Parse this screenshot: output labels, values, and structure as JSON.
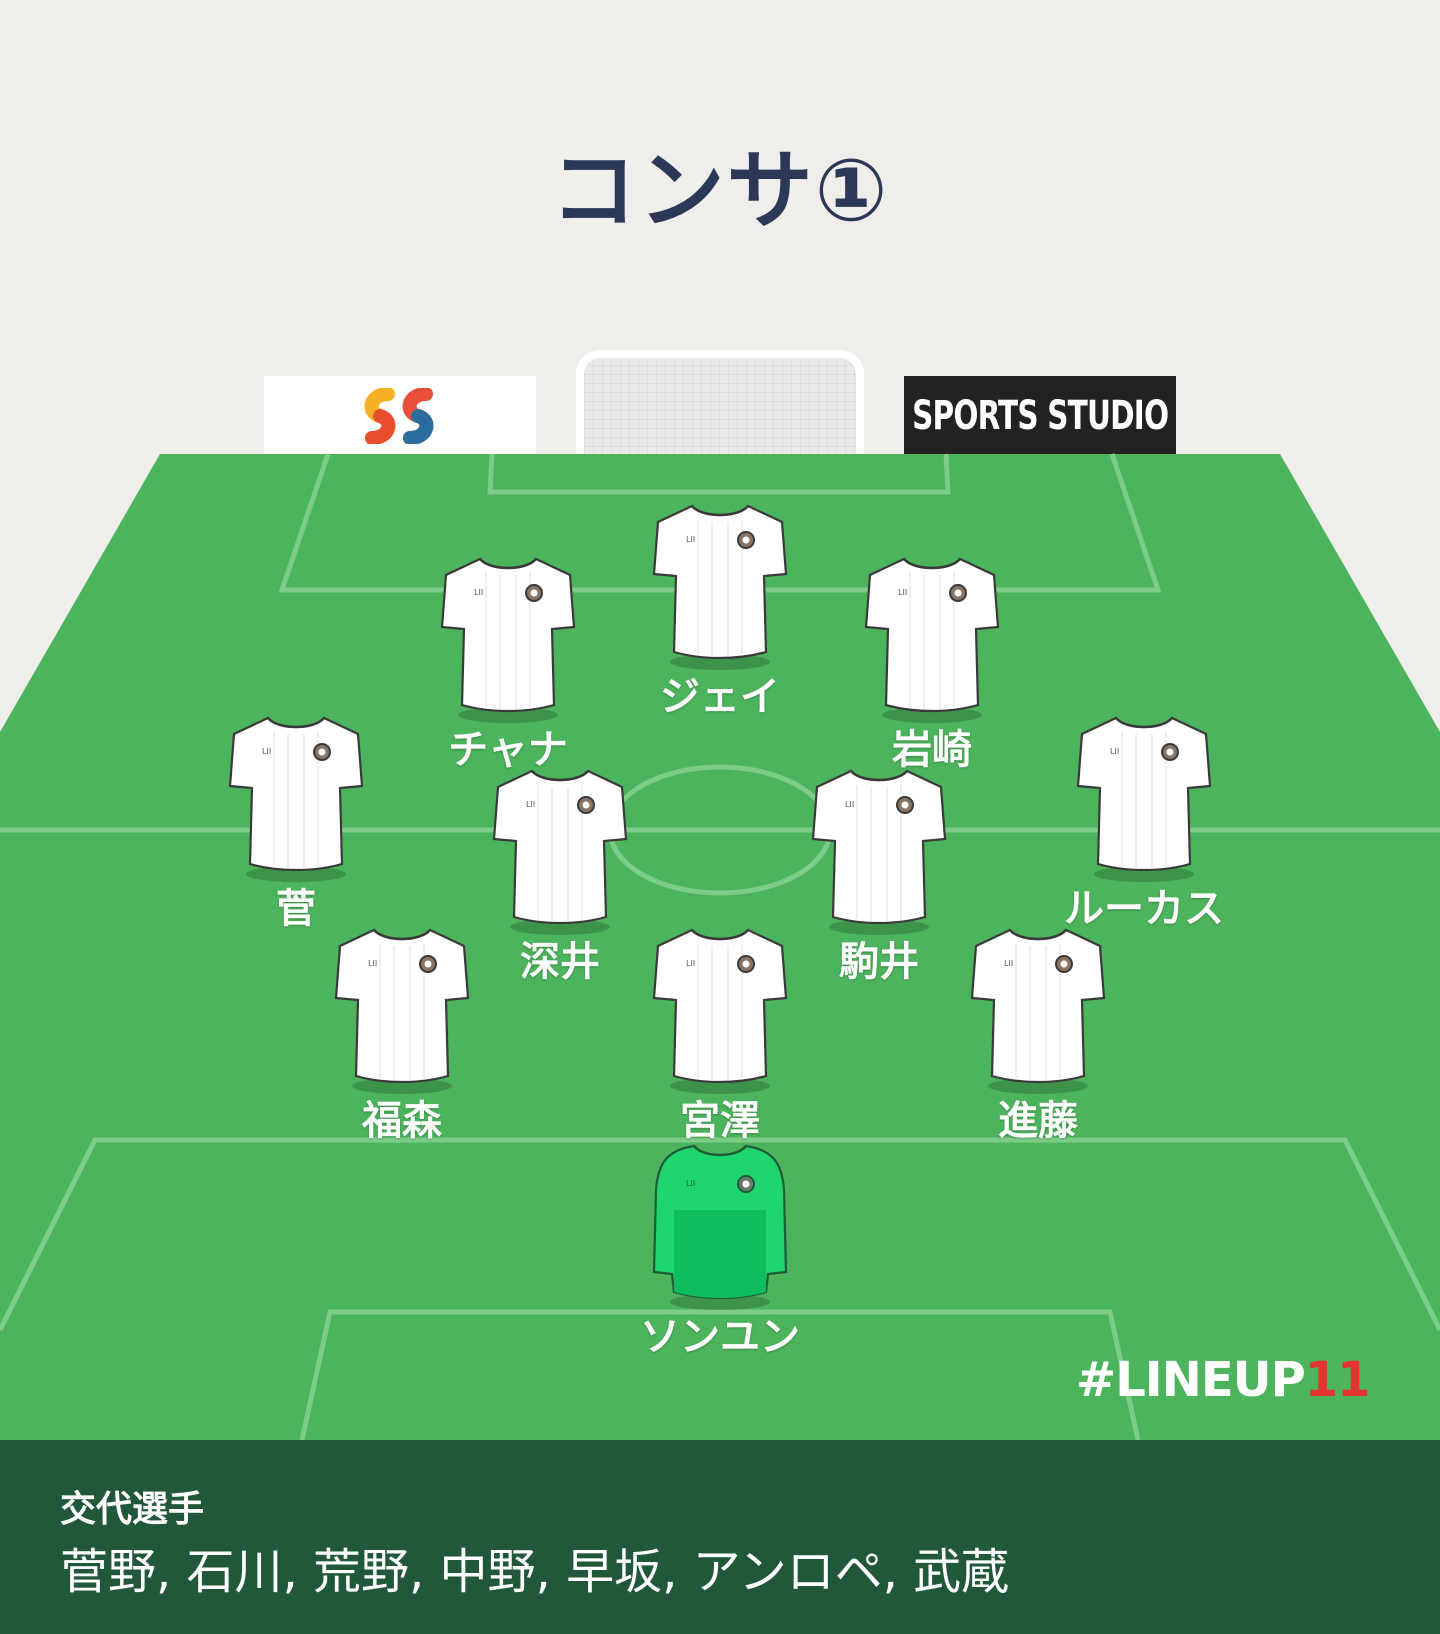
{
  "title": "コンサ①",
  "sponsors": {
    "left_logo": "ss-logo",
    "right_label": "SPORTS STUDIO"
  },
  "players": [
    {
      "id": "jay",
      "name": "ジェイ",
      "kit": "outfield"
    },
    {
      "id": "chanathip",
      "name": "チャナ",
      "kit": "outfield"
    },
    {
      "id": "iwasaki",
      "name": "岩崎",
      "kit": "outfield"
    },
    {
      "id": "suga",
      "name": "菅",
      "kit": "outfield"
    },
    {
      "id": "lucas",
      "name": "ルーカス",
      "kit": "outfield"
    },
    {
      "id": "fukai",
      "name": "深井",
      "kit": "outfield"
    },
    {
      "id": "komai",
      "name": "駒井",
      "kit": "outfield"
    },
    {
      "id": "fukumori",
      "name": "福森",
      "kit": "outfield"
    },
    {
      "id": "miyazawa",
      "name": "宮澤",
      "kit": "outfield"
    },
    {
      "id": "shindo",
      "name": "進藤",
      "kit": "outfield"
    },
    {
      "id": "sung-ryong",
      "name": "ソンユン",
      "kit": "goalkeeper"
    }
  ],
  "brand": {
    "main": "#LINEUP",
    "number": "11"
  },
  "substitutes": {
    "title": "交代選手",
    "list": "菅野, 石川, 荒野, 中野, 早坂, アンロペ, 武蔵"
  },
  "colors": {
    "pitch": "#4cb45c",
    "pitch_lines": "#7dcc87",
    "title": "#2c3857",
    "subs_bg": "#22583a",
    "gk_kit": "#1fd66e",
    "brand_red": "#e3342f"
  }
}
